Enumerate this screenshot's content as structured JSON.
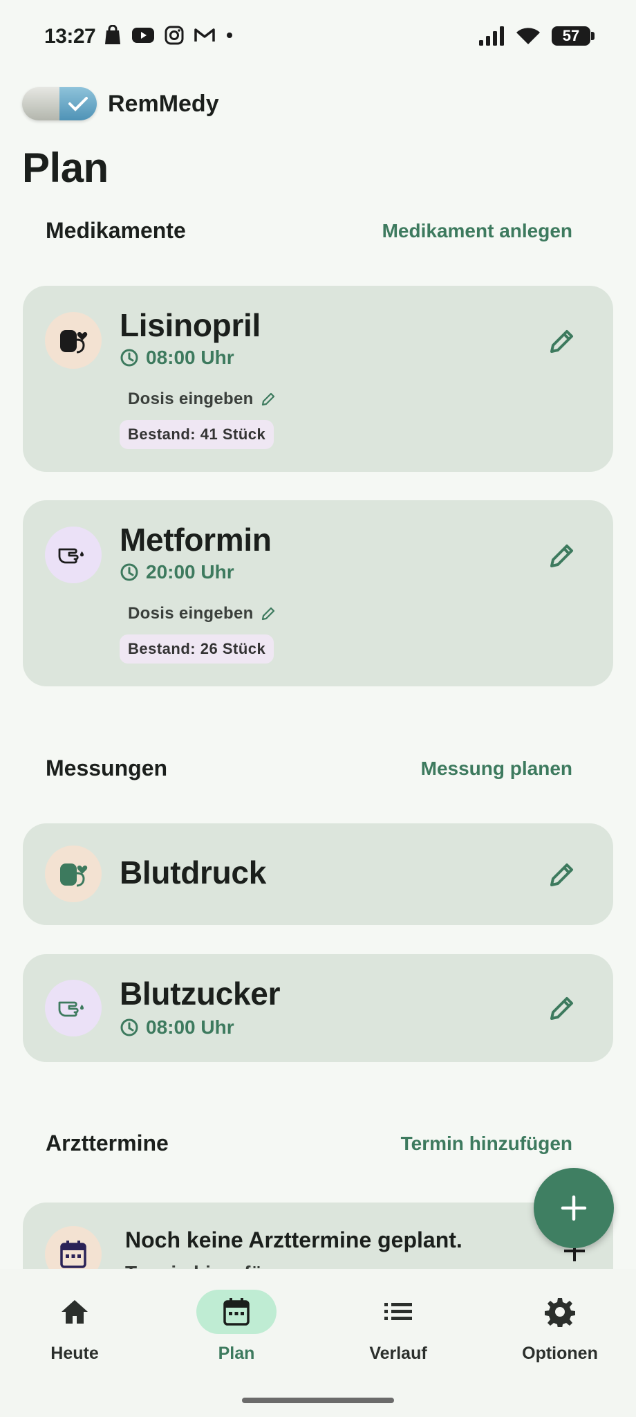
{
  "status_bar": {
    "time": "13:27",
    "battery": "57"
  },
  "app": {
    "name": "RemMedy",
    "page_title": "Plan"
  },
  "medications_section": {
    "heading": "Medikamente",
    "action": "Medikament anlegen",
    "items": [
      {
        "name": "Lisinopril",
        "time": "08:00 Uhr",
        "dose_label": "Dosis eingeben",
        "stock": "Bestand: 41 Stück",
        "icon": "blood-pressure-icon"
      },
      {
        "name": "Metformin",
        "time": "20:00 Uhr",
        "dose_label": "Dosis eingeben",
        "stock": "Bestand: 26 Stück",
        "icon": "finger-drop-icon"
      }
    ]
  },
  "measurements_section": {
    "heading": "Messungen",
    "action": "Messung planen",
    "items": [
      {
        "name": "Blutdruck",
        "icon": "blood-pressure-icon"
      },
      {
        "name": "Blutzucker",
        "time": "08:00 Uhr",
        "icon": "finger-drop-icon"
      }
    ]
  },
  "appointments_section": {
    "heading": "Arzttermine",
    "action": "Termin hinzufügen",
    "empty_title": "Noch keine Arzttermine geplant.",
    "empty_sub": "Termin hinzufügen"
  },
  "nav": [
    {
      "label": "Heute",
      "icon": "home-icon"
    },
    {
      "label": "Plan",
      "icon": "calendar-icon",
      "active": true
    },
    {
      "label": "Verlauf",
      "icon": "list-icon"
    },
    {
      "label": "Optionen",
      "icon": "gear-icon"
    }
  ],
  "colors": {
    "accent": "#3d7a5e",
    "card": "#dce5dc",
    "background": "#f5f8f4",
    "nav_active": "#bfecd3"
  }
}
